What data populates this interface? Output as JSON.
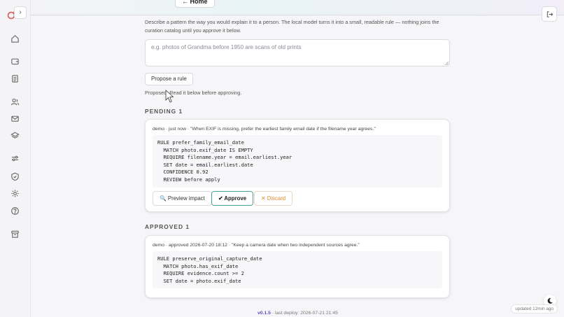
{
  "top": {
    "home_label": "← Home"
  },
  "intro_text": "Describe a pattern the way you would explain it to a person. The local model turns it into a small, readable rule — nothing joins the curation catalog until you approve it below.",
  "rule_input": {
    "value": "",
    "placeholder": "e.g. photos of Grandma before 1950 are scans of old prints"
  },
  "propose_label": "Propose a rule",
  "status_message": "Proposed. Read it below before approving.",
  "pending": {
    "heading": "PENDING 1",
    "card": {
      "meta": "demo · just now · \"When EXIF is missing, prefer the earliest family email date if the filename year agrees.\"",
      "code": [
        "RULE prefer_family_email_date",
        "  MATCH photo.exif_date IS EMPTY",
        "  REQUIRE filename.year = email.earliest.year",
        "  SET date = email.earliest.date",
        "  CONFIDENCE 0.92",
        "  REVIEW before apply"
      ],
      "actions": {
        "preview": "Preview impact",
        "approve": "✔ Approve",
        "discard": "✕ Discard"
      }
    }
  },
  "approved": {
    "heading": "APPROVED 1",
    "card": {
      "meta": "demo · approved 2026-07-20 18:12 · \"Keep a camera date when two independent sources agree.\"",
      "code": [
        "RULE preserve_original_capture_date",
        "  MATCH photo.has_exif_date",
        "  REQUIRE evidence.count >= 2",
        "  SET date = photo.exif_date"
      ]
    }
  },
  "footer": {
    "version": "v0.1.5",
    "deploy": " · last deploy: 2026-07-21 21:45"
  },
  "updated_label": "updated 12min ago",
  "icons": {
    "logo": "photo-logo-icon",
    "nav": [
      "home-icon",
      "wallet-icon",
      "document-icon",
      "people-icon",
      "mail-icon",
      "layers-icon",
      "sliders-icon",
      "shield-icon",
      "sparkle-icon",
      "help-icon",
      "archive-icon"
    ]
  },
  "colors": {
    "accent": "#5c4fc0",
    "approve_border": "#4aa39a",
    "discard": "#e08b2e",
    "logo": "#d9534f"
  }
}
